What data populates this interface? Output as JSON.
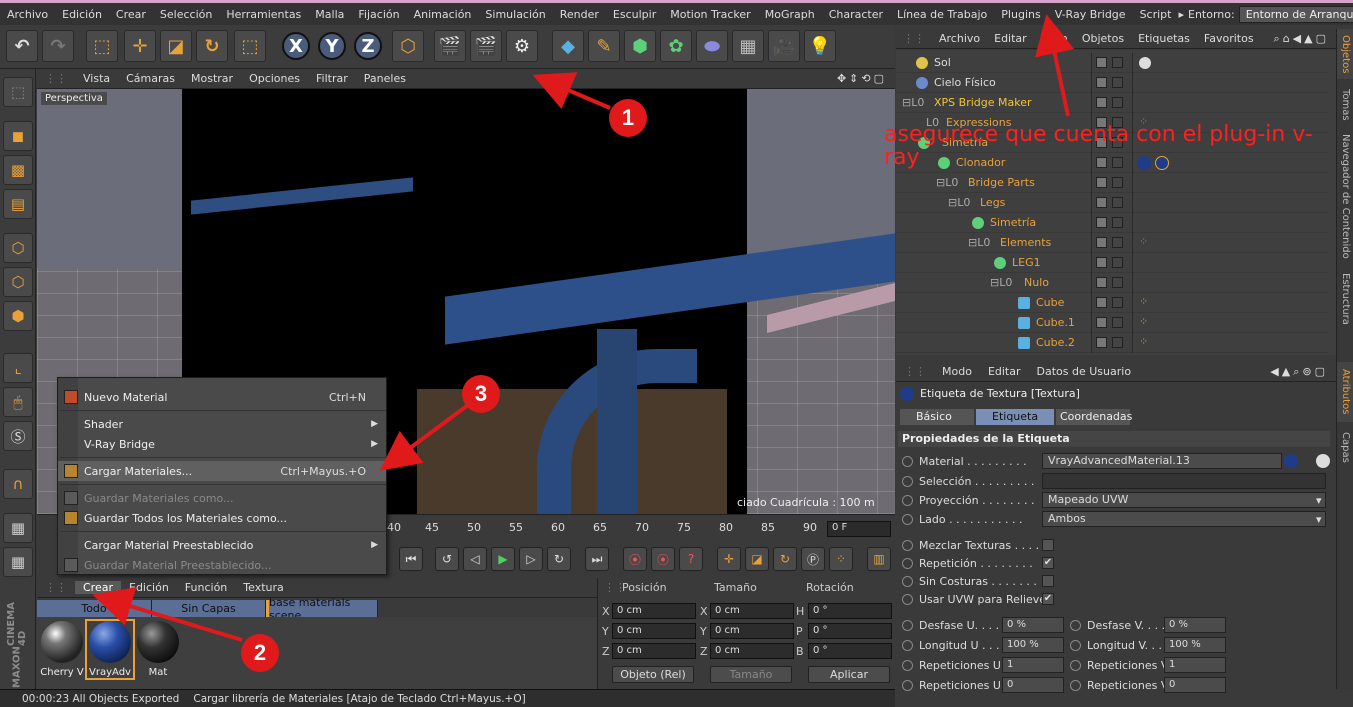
{
  "menubar": {
    "items": [
      "Archivo",
      "Edición",
      "Crear",
      "Selección",
      "Herramientas",
      "Malla",
      "Fijación",
      "Animación",
      "Simulación",
      "Render",
      "Esculpir",
      "Motion Tracker",
      "MoGraph",
      "Character",
      "Línea de Trabajo",
      "Plugins",
      "V-Ray Bridge",
      "Script"
    ],
    "env_label": "Entorno:",
    "env_value": "Entorno de Arranque"
  },
  "toolbar": {
    "axes": [
      "X",
      "Y",
      "Z"
    ]
  },
  "viewport": {
    "menu": [
      "Vista",
      "Cámaras",
      "Mostrar",
      "Opciones",
      "Filtrar",
      "Paneles"
    ],
    "label": "Perspectiva",
    "grid_info": "ciado Cuadrícula : 100 m"
  },
  "timeline": {
    "ticks": [
      "40",
      "45",
      "50",
      "55",
      "60",
      "65",
      "70",
      "75",
      "80",
      "85",
      "90"
    ],
    "frame": "0 F"
  },
  "material_manager": {
    "menu": [
      "Crear",
      "Edición",
      "Función",
      "Textura"
    ],
    "tabs": [
      "Todo",
      "Sin Capas",
      "base materials scene"
    ],
    "materials": [
      {
        "name": "Cherry V"
      },
      {
        "name": "VrayAdv"
      },
      {
        "name": "Mat"
      }
    ]
  },
  "coords": {
    "headers": [
      "Posición",
      "Tamaño",
      "Rotación"
    ],
    "rows": [
      {
        "a": "X",
        "av": "0 cm",
        "b": "X",
        "bv": "0 cm",
        "c": "H",
        "cv": "0 °"
      },
      {
        "a": "Y",
        "av": "0 cm",
        "b": "Y",
        "bv": "0 cm",
        "c": "P",
        "cv": "0 °"
      },
      {
        "a": "Z",
        "av": "0 cm",
        "b": "Z",
        "bv": "0 cm",
        "c": "B",
        "cv": "0 °"
      }
    ],
    "mode": "Objeto (Rel)",
    "size_mode": "Tamaño",
    "apply": "Aplicar"
  },
  "context_menu": {
    "items": [
      {
        "label": "Nuevo Material",
        "shortcut": "Ctrl+N"
      },
      {
        "label": "Shader",
        "shortcut": ""
      },
      {
        "label": "V-Ray Bridge",
        "shortcut": ""
      },
      {
        "label": "Cargar Materiales...",
        "shortcut": "Ctrl+Mayus.+O"
      },
      {
        "label": "Guardar Materiales como...",
        "shortcut": ""
      },
      {
        "label": "Guardar Todos los Materiales como...",
        "shortcut": ""
      },
      {
        "label": "Cargar Material Preestablecido",
        "shortcut": ""
      },
      {
        "label": "Guardar Material Preestablecido...",
        "shortcut": ""
      }
    ]
  },
  "object_manager": {
    "menu": [
      "Archivo",
      "Editar",
      "Vista",
      "Objetos",
      "Etiquetas",
      "Favoritos"
    ],
    "objects": [
      {
        "name": "Sol"
      },
      {
        "name": "Cielo Físico"
      },
      {
        "name": "XPS Bridge Maker"
      },
      {
        "name": "Expressions"
      },
      {
        "name": "Simetría"
      },
      {
        "name": "Clonador"
      },
      {
        "name": "Bridge Parts"
      },
      {
        "name": "Legs"
      },
      {
        "name": "Simetría"
      },
      {
        "name": "Elements"
      },
      {
        "name": "LEG1"
      },
      {
        "name": "Nulo"
      },
      {
        "name": "Cube"
      },
      {
        "name": "Cube.1"
      },
      {
        "name": "Cube.2"
      }
    ]
  },
  "attribute_manager": {
    "menu": [
      "Modo",
      "Editar",
      "Datos de Usuario"
    ],
    "title": "Etiqueta de Textura [Textura]",
    "tabs": [
      "Básico",
      "Etiqueta",
      "Coordenadas"
    ],
    "section": "Propiedades de la Etiqueta",
    "material_label": "Material . . . . . . . . .",
    "material_value": "VrayAdvancedMaterial.13",
    "seleccion": "Selección . . . . . . . . .",
    "proyeccion": "Proyección . . . . . . . .",
    "proyeccion_value": "Mapeado UVW",
    "lado": "Lado . . . . . . . . . . .",
    "lado_value": "Ambos",
    "mezclar": "Mezclar Texturas . . . . .",
    "repeticion": "Repetición . . . . . . . .",
    "sin_costuras": "Sin Costuras . . . . . . .",
    "usar_uvw": "Usar UVW para Relieve",
    "desfase_u": "Desfase U. . . . . .",
    "desfase_u_v": "0 %",
    "desfase_v": "Desfase V. . . . . .",
    "desfase_v_v": "0 %",
    "long_u": "Longitud U . . . .",
    "long_u_v": "100 %",
    "long_v": "Longitud V. . . . .",
    "long_v_v": "100 %",
    "rep_u": "Repeticiones U",
    "rep_u_v": "1",
    "rep_v": "Repeticiones V",
    "rep_v_v": "1",
    "rep_u2": "Repeticiones U",
    "rep_u2_v": "0",
    "rep_v2": "Repeticiones V",
    "rep_v2_v": "0"
  },
  "side_tabs": [
    "Objetos",
    "Tomas",
    "Navegador de Contenido",
    "Estructura",
    "Atributos",
    "Capas"
  ],
  "status": {
    "time": "00:00:23 All Objects Exported",
    "message": "Cargar librería de Materiales [Atajo de Teclado Ctrl+Mayus.+O]"
  },
  "logo": {
    "line1": "MAXON",
    "line2": "CINEMA 4D"
  },
  "annotation": {
    "text": "asegurece que cuenta con el plug-in v-ray",
    "badges": [
      "1",
      "2",
      "3"
    ]
  },
  "colors": {
    "accent": "#e9a13a",
    "annotation": "#ff2020",
    "orange_text": "#e9a13a",
    "selection_blue": "#5a6e96"
  }
}
